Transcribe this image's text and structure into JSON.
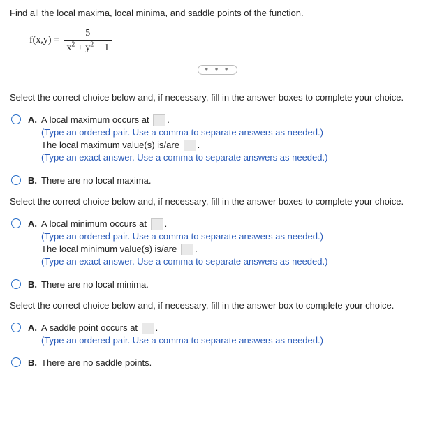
{
  "problem": {
    "title": "Find all the local maxima, local minima, and saddle points of the function.",
    "func_left": "f(x,y) =",
    "numerator": "5",
    "denom_x": "x",
    "denom_plus": " + ",
    "denom_y": "y",
    "denom_minus_one": " − 1",
    "exp": "2"
  },
  "separator": "• • •",
  "sections": {
    "max": {
      "instr": "Select the correct choice below and, if necessary, fill in the answer boxes to complete your choice.",
      "A": {
        "label": "A.",
        "line1_pre": "A local maximum occurs at ",
        "line1_post": ".",
        "hint1": "(Type an ordered pair. Use a comma to separate answers as needed.)",
        "line2_pre": "The local maximum value(s) is/are ",
        "line2_post": ".",
        "hint2": "(Type an exact answer. Use a comma to separate answers as needed.)"
      },
      "B": {
        "label": "B.",
        "text": "There are no local maxima."
      }
    },
    "min": {
      "instr": "Select the correct choice below and, if necessary, fill in the answer boxes to complete your choice.",
      "A": {
        "label": "A.",
        "line1_pre": "A local minimum occurs at ",
        "line1_post": ".",
        "hint1": "(Type an ordered pair. Use a comma to separate answers as needed.)",
        "line2_pre": "The local minimum value(s) is/are ",
        "line2_post": ".",
        "hint2": "(Type an exact answer. Use a comma to separate answers as needed.)"
      },
      "B": {
        "label": "B.",
        "text": "There are no local minima."
      }
    },
    "saddle": {
      "instr": "Select the correct choice below and, if necessary, fill in the answer box to complete your choice.",
      "A": {
        "label": "A.",
        "line1_pre": "A saddle point occurs at ",
        "line1_post": ".",
        "hint1": "(Type an ordered pair. Use a comma to separate answers as needed.)"
      },
      "B": {
        "label": "B.",
        "text": "There are no saddle points."
      }
    }
  }
}
